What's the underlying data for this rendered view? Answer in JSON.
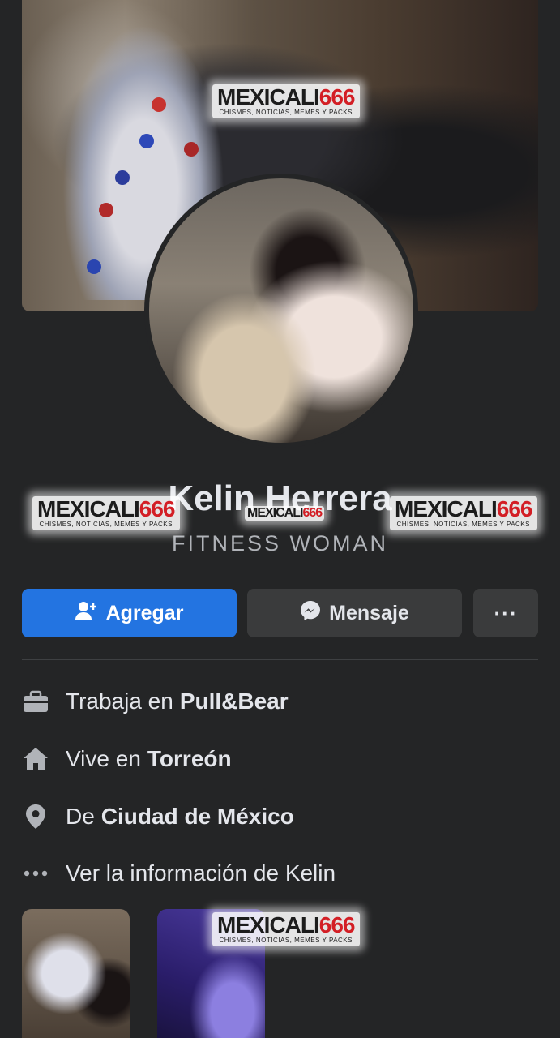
{
  "profile": {
    "name": "Kelin Herrera",
    "bio": "FITNESS WOMAN"
  },
  "watermark": {
    "brand_part1": "MEXICALI",
    "brand_part2": "666",
    "tagline": "CHISMES, NOTICIAS, MEMES Y PACKS"
  },
  "actions": {
    "add_label": "Agregar",
    "message_label": "Mensaje",
    "more_label": "···"
  },
  "details": [
    {
      "icon": "briefcase-icon",
      "prefix": "Trabaja en",
      "value": "Pull&Bear"
    },
    {
      "icon": "home-icon",
      "prefix": "Vive en",
      "value": "Torreón"
    },
    {
      "icon": "location-pin-icon",
      "prefix": "De",
      "value": "Ciudad de México"
    },
    {
      "icon": "more-dots-icon",
      "prefix": "Ver la información de Kelin",
      "value": ""
    }
  ],
  "colors": {
    "background": "#242526",
    "primary_button": "#2374e1",
    "secondary_button": "#3a3b3c",
    "watermark_red": "#d31e25"
  }
}
